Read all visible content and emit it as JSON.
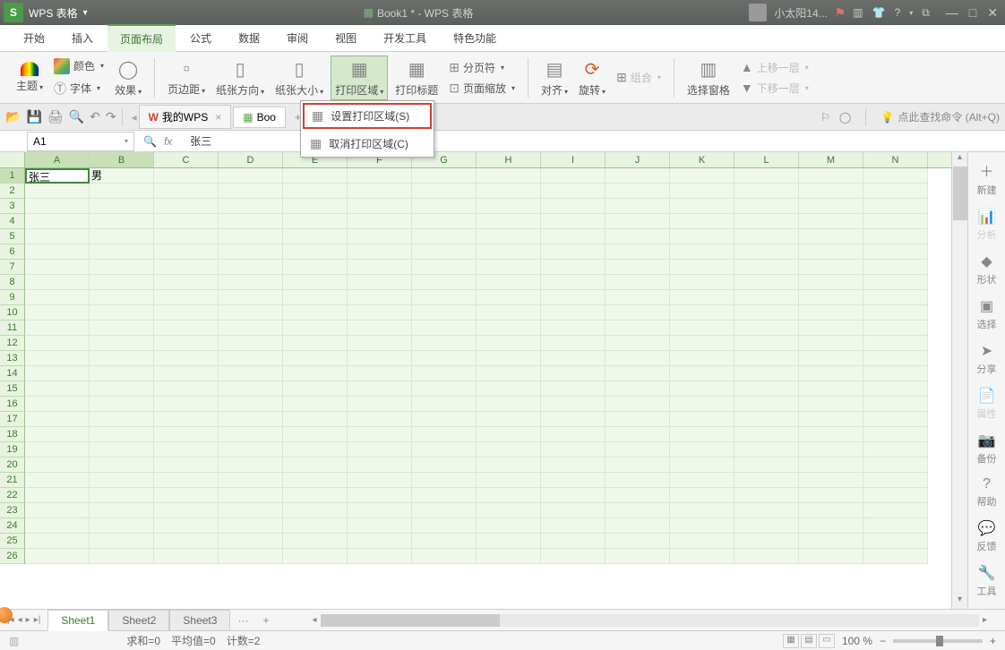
{
  "titlebar": {
    "app_name": "WPS 表格",
    "doc_title": "Book1 * - WPS 表格",
    "user_name": "小太阳14...",
    "help_char": "?",
    "min": "—",
    "max": "□",
    "close": "✕"
  },
  "menu": {
    "items": [
      "开始",
      "插入",
      "页面布局",
      "公式",
      "数据",
      "审阅",
      "视图",
      "开发工具",
      "特色功能"
    ],
    "active_index": 2
  },
  "ribbon": {
    "theme": "主题",
    "colors": "颜色",
    "font": "字体",
    "effect": "效果",
    "margins": "页边距",
    "orientation": "纸张方向",
    "size": "纸张大小",
    "print_area": "打印区域",
    "print_titles": "打印标题",
    "scale": "页面缩放",
    "breaks": "分页符",
    "align": "对齐",
    "rotate": "旋转",
    "group": "组合",
    "selection_pane": "选择窗格",
    "bring_forward": "上移一层",
    "send_backward": "下移一层"
  },
  "dropdown": {
    "set_print_area": "设置打印区域(S)",
    "clear_print_area": "取消打印区域(C)"
  },
  "qat": {
    "my_wps": "我的WPS",
    "book_tab": "Boo",
    "search_hint": "点此查找命令 (Alt+Q)"
  },
  "formula": {
    "name_box": "A1",
    "fx": "fx",
    "value": "张三"
  },
  "sheet": {
    "columns": [
      "A",
      "B",
      "C",
      "D",
      "E",
      "F",
      "G",
      "H",
      "I",
      "J",
      "K",
      "L",
      "M",
      "N"
    ],
    "rows": 26,
    "cells": {
      "A1": "张三",
      "B1": "男"
    }
  },
  "side_panel": {
    "items": [
      {
        "icon": "＋",
        "label": "新建",
        "enabled": true
      },
      {
        "icon": "📊",
        "label": "分析",
        "enabled": false
      },
      {
        "icon": "◆",
        "label": "形状",
        "enabled": true
      },
      {
        "icon": "▣",
        "label": "选择",
        "enabled": true
      },
      {
        "icon": "➤",
        "label": "分享",
        "enabled": true
      },
      {
        "icon": "📄",
        "label": "属性",
        "enabled": false
      },
      {
        "icon": "📷",
        "label": "备份",
        "enabled": true
      },
      {
        "icon": "?",
        "label": "帮助",
        "enabled": true
      },
      {
        "icon": "💬",
        "label": "反馈",
        "enabled": true
      },
      {
        "icon": "🔧",
        "label": "工具",
        "enabled": true
      }
    ]
  },
  "sheet_tabs": {
    "tabs": [
      "Sheet1",
      "Sheet2",
      "Sheet3"
    ],
    "active_index": 0,
    "more": "···",
    "add": "+"
  },
  "status": {
    "sum": "求和=0",
    "avg": "平均值=0",
    "count": "计数=2",
    "zoom": "100 %"
  }
}
